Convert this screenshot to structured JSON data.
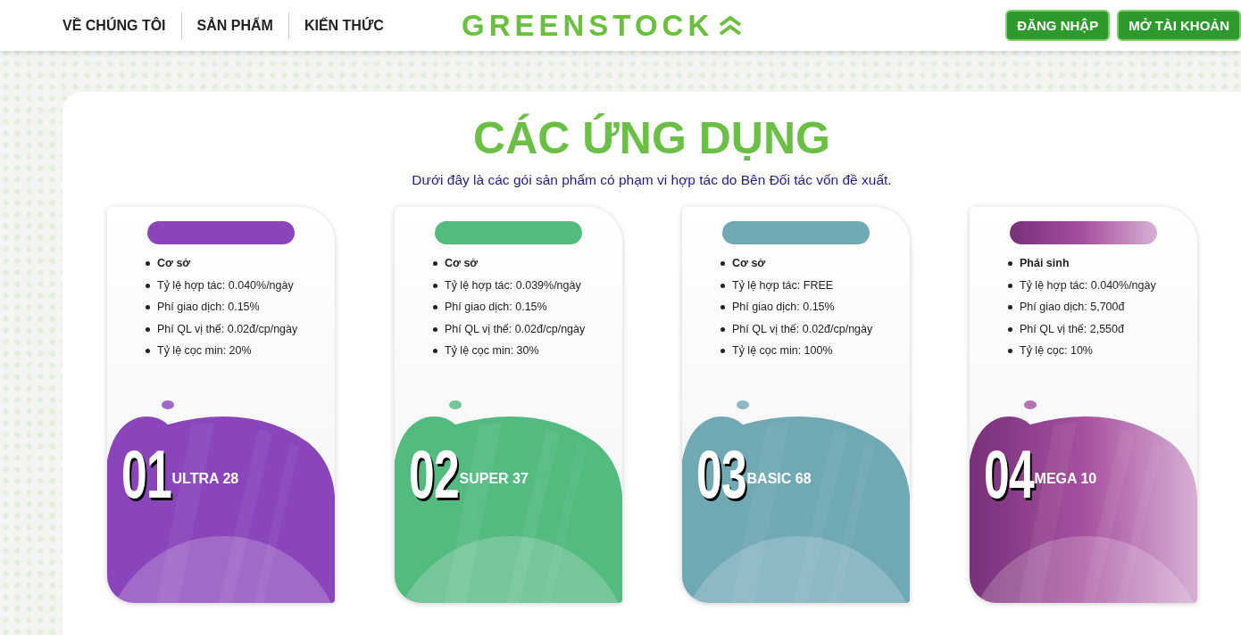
{
  "nav": {
    "links": [
      "VỀ CHÚNG TÔI",
      "SẢN PHẨM",
      "KIẾN THỨC"
    ],
    "logo": "GREENSTOCK",
    "buttons": [
      "ĐĂNG NHẬP",
      "MỞ TÀI KHOẢN"
    ]
  },
  "section": {
    "title": "CÁC ỨNG DỤNG",
    "subtitle": "Dưới đây là các gói sản phẩm có phạm vi hợp tác do Bên Đối tác vốn đề xuất."
  },
  "cards": [
    {
      "color": "#8a45bb",
      "kind": "solid",
      "category": "Cơ sở",
      "features": [
        "Tỷ lệ hợp tác: 0.040%/ngày",
        "Phí giao dịch: 0.15%",
        "Phí QL vị thế: 0.02đ/cp/ngày",
        "Tỷ lệ cọc min: 20%"
      ],
      "number": "01",
      "name": "ULTRA 28"
    },
    {
      "color": "#53ba80",
      "kind": "solid",
      "category": "Cơ sở",
      "features": [
        "Tỷ lệ hợp tác: 0.039%/ngày",
        "Phí giao dịch: 0.15%",
        "Phí QL vị thế: 0.02đ/cp/ngày",
        "Tỷ lệ cọc min: 30%"
      ],
      "number": "02",
      "name": "SUPER 37"
    },
    {
      "color": "#70a8b4",
      "kind": "solid",
      "category": "Cơ sở",
      "features": [
        "Tỷ lệ hợp tác: FREE",
        "Phí giao dịch: 0.15%",
        "Phí QL vị thế: 0.02đ/cp/ngày",
        "Tỷ lệ cọc min: 100%"
      ],
      "number": "03",
      "name": "BASIC 68"
    },
    {
      "color": "#a6509f",
      "kind": "gradient",
      "category": "Phái sinh",
      "features": [
        "Tỷ lệ hợp tác: 0.040%/ngày",
        "Phí giao dịch: 5,700đ",
        "Phí QL vị thế: 2,550đ",
        "Tỷ lệ cọc: 10%"
      ],
      "number": "04",
      "name": "MEGA 10"
    }
  ]
}
